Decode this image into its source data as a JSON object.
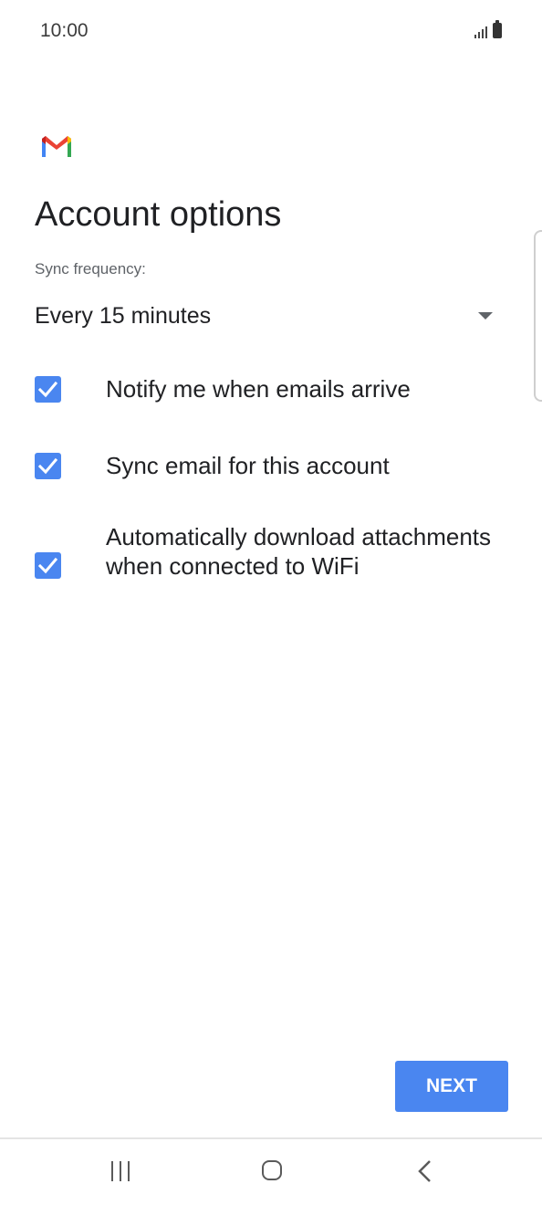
{
  "status_bar": {
    "time": "10:00",
    "icons": [
      "signal-icon",
      "battery-icon"
    ]
  },
  "header": {
    "logo_icon": "gmail-logo-icon",
    "title": "Account options"
  },
  "sync": {
    "label": "Sync frequency:",
    "value": "Every 15 minutes",
    "arrow_icon": "dropdown-arrow-icon"
  },
  "options": [
    {
      "label": "Notify me when emails arrive",
      "checked": true
    },
    {
      "label": "Sync email for this account",
      "checked": true
    },
    {
      "label": "Automatically download attachments when connected to WiFi",
      "checked": true
    }
  ],
  "actions": {
    "next_label": "NEXT"
  },
  "nav_bar": {
    "icons": [
      "recents-icon",
      "home-icon",
      "back-icon"
    ]
  },
  "colors": {
    "accent": "#4a86f0",
    "text_primary": "#202124",
    "text_secondary": "#5f6368",
    "gmail_red": "#ea4335",
    "gmail_blue": "#4285f4",
    "gmail_green": "#34a853",
    "gmail_yellow": "#fbbc04"
  }
}
